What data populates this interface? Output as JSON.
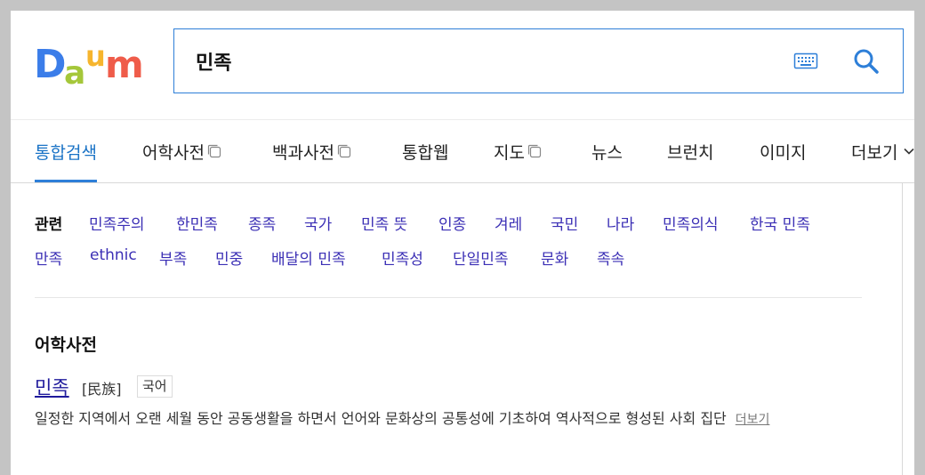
{
  "logo": {
    "letters": [
      "D",
      "a",
      "u",
      "m"
    ],
    "colors": [
      "#3b7de9",
      "#a5c73a",
      "#f6b52e",
      "#ef5c4a"
    ]
  },
  "search": {
    "value": "민족",
    "keyboard_icon": "keyboard-icon",
    "search_icon": "magnifier-icon",
    "accent": "#2e7fd8"
  },
  "tabs": [
    {
      "label": "통합검색",
      "active": true
    },
    {
      "label": "어학사전",
      "popup": true
    },
    {
      "label": "백과사전",
      "popup": true
    },
    {
      "label": "통합웹"
    },
    {
      "label": "지도",
      "popup": true
    },
    {
      "label": "뉴스"
    },
    {
      "label": "브런치"
    },
    {
      "label": "이미지"
    },
    {
      "label": "더보기",
      "chevron": true
    }
  ],
  "related": {
    "label": "관련",
    "row1": [
      "민족주의",
      "한민족",
      "종족",
      "국가",
      "민족 뜻",
      "인종",
      "겨레",
      "국민",
      "나라",
      "민족의식",
      "한국 민족"
    ],
    "row2": [
      "만족",
      "ethnic",
      "부족",
      "민중",
      "배달의 민족",
      "민족성",
      "단일민족",
      "문화",
      "족속"
    ]
  },
  "dictionary": {
    "title": "어학사전",
    "word": "민족",
    "hanja": "[民族]",
    "badge": "국어",
    "definition": "일정한 지역에서 오랜 세월 동안 공동생활을 하면서 언어와 문화상의 공통성에 기초하여 역사적으로 형성된 사회 집단",
    "more": "더보기"
  }
}
